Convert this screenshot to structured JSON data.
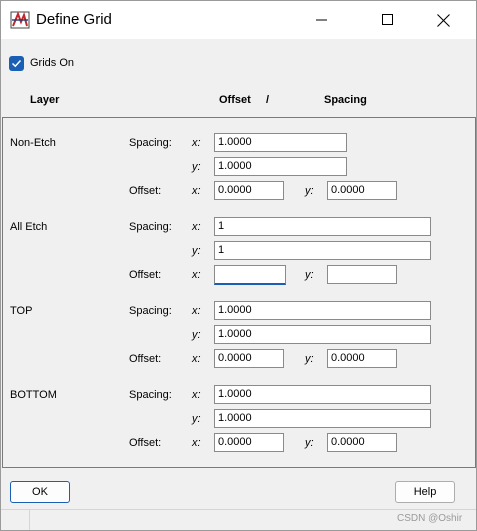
{
  "window": {
    "title": "Define Grid",
    "minimize_symbol": "",
    "maximize_symbol": "",
    "close_symbol": ""
  },
  "grids_on": {
    "label": "Grids On",
    "checked": true
  },
  "headers": {
    "layer": "Layer",
    "offset": "Offset",
    "separator": "/",
    "spacing": "Spacing"
  },
  "field_labels": {
    "spacing": "Spacing:",
    "offset": "Offset:",
    "x": "x:",
    "y": "y:"
  },
  "layers": [
    {
      "name": "Non-Etch",
      "spacing_x": "1.0000",
      "spacing_y": "1.0000",
      "offset_x": "0.0000",
      "offset_y": "0.0000"
    },
    {
      "name": "All Etch",
      "spacing_x": "1",
      "spacing_y": "1",
      "offset_x": "",
      "offset_y": ""
    },
    {
      "name": "TOP",
      "spacing_x": "1.0000",
      "spacing_y": "1.0000",
      "offset_x": "0.0000",
      "offset_y": "0.0000"
    },
    {
      "name": "BOTTOM",
      "spacing_x": "1.0000",
      "spacing_y": "1.0000",
      "offset_x": "0.0000",
      "offset_y": "0.0000"
    }
  ],
  "buttons": {
    "ok": "OK",
    "help": "Help"
  },
  "watermark": "CSDN @Oshir",
  "colors": {
    "accent": "#1a5fb4",
    "background": "#f0f0f0",
    "titlebar": "#ffffff"
  }
}
